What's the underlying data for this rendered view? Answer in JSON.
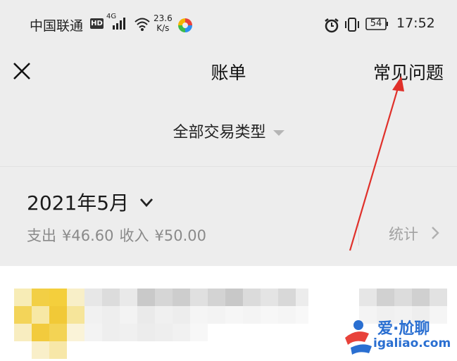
{
  "status_bar": {
    "carrier": "中国联通",
    "hd": "HD",
    "network": "4G",
    "speed_value": "23.6",
    "speed_unit": "K/s",
    "battery": "54",
    "time": "17:52"
  },
  "nav": {
    "title": "账单",
    "faq": "常见问题"
  },
  "filter": {
    "label": "全部交易类型"
  },
  "month": {
    "label": "2021年5月",
    "expense_label": "支出",
    "expense_amount": "¥46.60",
    "income_label": "收入",
    "income_amount": "¥50.00",
    "stats_label": "统计"
  },
  "watermark": {
    "top": "爱·尬聊",
    "bottom": "igaliao.com"
  },
  "colors": {
    "background": "#ededed",
    "annotation_arrow": "#e0302a",
    "watermark": "#2a6fd1"
  }
}
